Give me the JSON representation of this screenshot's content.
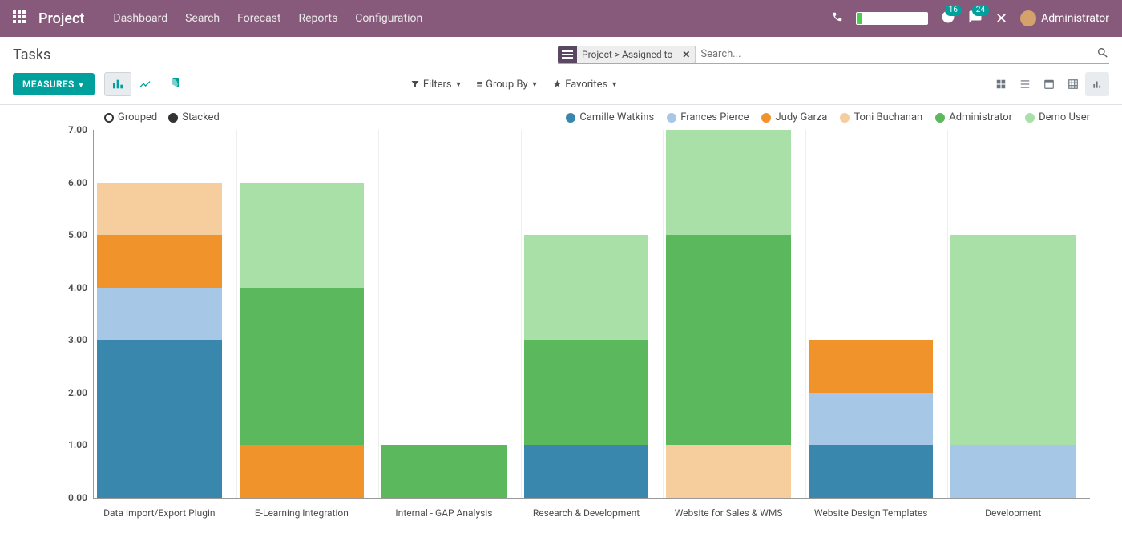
{
  "navbar": {
    "brand": "Project",
    "menu": [
      "Dashboard",
      "Search",
      "Forecast",
      "Reports",
      "Configuration"
    ],
    "progress_pct": 8,
    "badge_msg": "16",
    "badge_chat": "24",
    "user": "Administrator"
  },
  "breadcrumb": "Tasks",
  "search": {
    "facet": "Project > Assigned to",
    "placeholder": "Search..."
  },
  "toolbar": {
    "measures": "MEASURES",
    "filters": "Filters",
    "groupby": "Group By",
    "favorites": "Favorites"
  },
  "mode": {
    "grouped": "Grouped",
    "stacked": "Stacked",
    "active": "stacked"
  },
  "series_colors": {
    "Camille Watkins": "#3a87ad",
    "Frances Pierce": "#a7c7e7",
    "Judy Garza": "#f0932b",
    "Toni Buchanan": "#f6cd9c",
    "Administrator": "#5cb85c",
    "Demo User": "#a8e0a8"
  },
  "chart_data": {
    "type": "bar",
    "stacked": true,
    "ylabel": "",
    "xlabel": "",
    "ylim": [
      0,
      7
    ],
    "yticks": [
      0.0,
      1.0,
      2.0,
      3.0,
      4.0,
      5.0,
      6.0,
      7.0
    ],
    "categories": [
      "Data Import/Export Plugin",
      "E-Learning Integration",
      "Internal - GAP Analysis",
      "Research & Development",
      "Website for Sales & WMS",
      "Website Design Templates",
      "Development"
    ],
    "series": [
      {
        "name": "Camille Watkins",
        "values": [
          3,
          0,
          0,
          1,
          0,
          1,
          0
        ]
      },
      {
        "name": "Frances Pierce",
        "values": [
          1,
          0,
          0,
          0,
          0,
          1,
          1
        ]
      },
      {
        "name": "Judy Garza",
        "values": [
          1,
          1,
          0,
          0,
          0,
          1,
          0
        ]
      },
      {
        "name": "Toni Buchanan",
        "values": [
          1,
          0,
          0,
          0,
          1,
          0,
          0
        ]
      },
      {
        "name": "Administrator",
        "values": [
          0,
          3,
          1,
          2,
          4,
          0,
          0
        ]
      },
      {
        "name": "Demo User",
        "values": [
          0,
          2,
          0,
          2,
          2,
          0,
          4
        ]
      }
    ]
  }
}
